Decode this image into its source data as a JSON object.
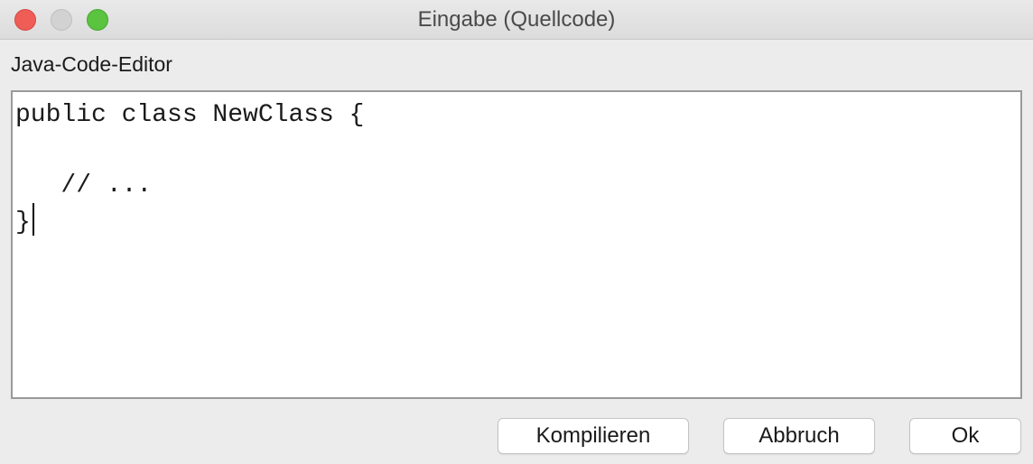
{
  "window": {
    "title": "Eingabe (Quellcode)"
  },
  "editor": {
    "label": "Java-Code-Editor",
    "lines": [
      "public class NewClass {",
      "",
      "   // ...",
      "}"
    ]
  },
  "buttons": {
    "compile_label": "Kompilieren",
    "cancel_label": "Abbruch",
    "ok_label": "Ok"
  },
  "colors": {
    "close": "#ee5e57",
    "minimize": "#d2d2d2",
    "zoom": "#5ac33f"
  }
}
